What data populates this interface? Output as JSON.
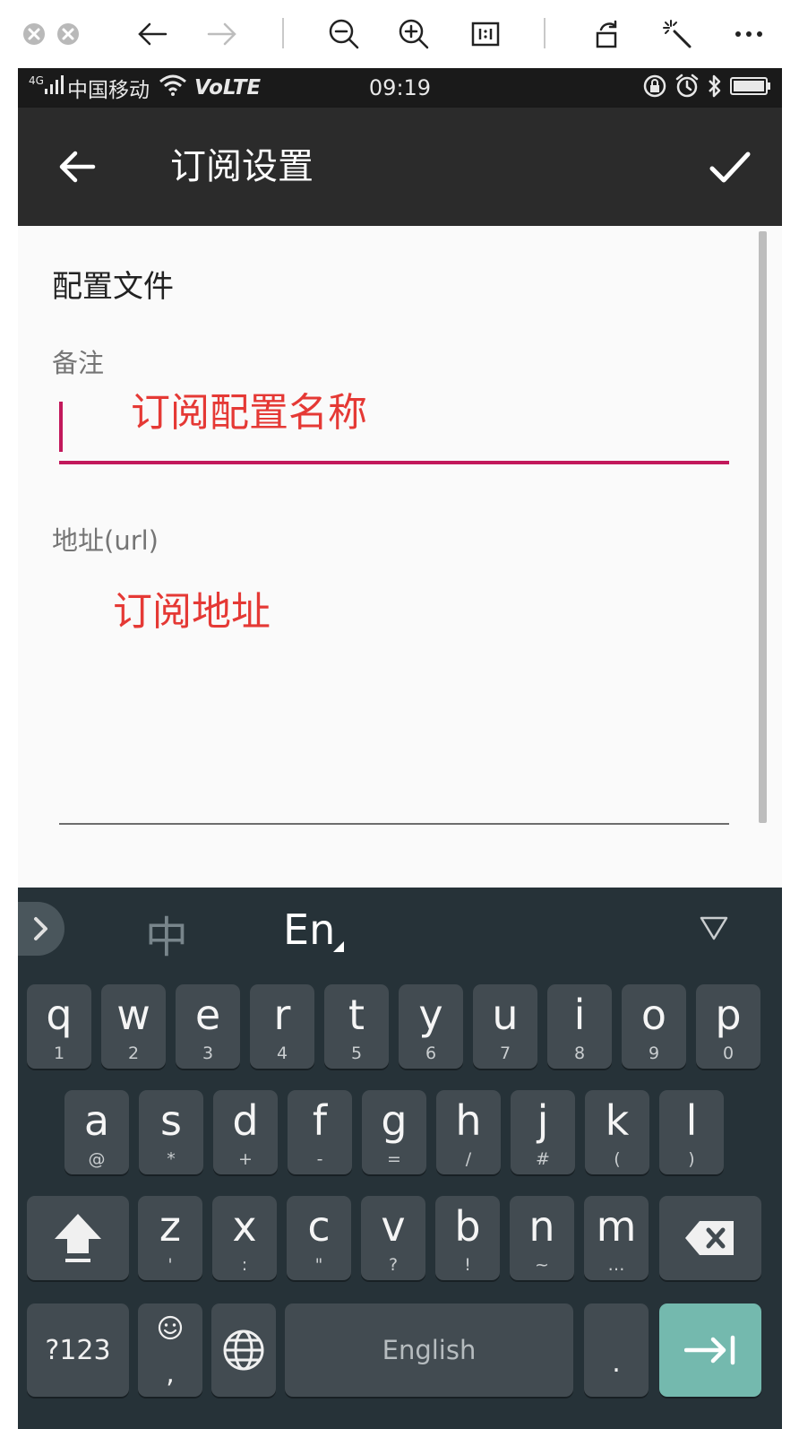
{
  "status_bar": {
    "network": "4G",
    "carrier": "中国移动",
    "volte": "VoLTE",
    "time": "09:19"
  },
  "app_bar": {
    "title": "订阅设置"
  },
  "form": {
    "section_title": "配置文件",
    "remark_label": "备注",
    "remark_hint": "订阅配置名称",
    "url_label": "地址(url)",
    "url_hint": "订阅地址"
  },
  "keyboard": {
    "lang_zh": "中",
    "lang_en": "En",
    "row1": [
      {
        "main": "q",
        "sub": "1"
      },
      {
        "main": "w",
        "sub": "2"
      },
      {
        "main": "e",
        "sub": "3"
      },
      {
        "main": "r",
        "sub": "4"
      },
      {
        "main": "t",
        "sub": "5"
      },
      {
        "main": "y",
        "sub": "6"
      },
      {
        "main": "u",
        "sub": "7"
      },
      {
        "main": "i",
        "sub": "8"
      },
      {
        "main": "o",
        "sub": "9"
      },
      {
        "main": "p",
        "sub": "0"
      }
    ],
    "row2": [
      {
        "main": "a",
        "sub": "@"
      },
      {
        "main": "s",
        "sub": "*"
      },
      {
        "main": "d",
        "sub": "+"
      },
      {
        "main": "f",
        "sub": "-"
      },
      {
        "main": "g",
        "sub": "="
      },
      {
        "main": "h",
        "sub": "/"
      },
      {
        "main": "j",
        "sub": "#"
      },
      {
        "main": "k",
        "sub": "("
      },
      {
        "main": "l",
        "sub": ")"
      }
    ],
    "row3": [
      {
        "main": "z",
        "sub": "'"
      },
      {
        "main": "x",
        "sub": ":"
      },
      {
        "main": "c",
        "sub": "\""
      },
      {
        "main": "v",
        "sub": "?"
      },
      {
        "main": "b",
        "sub": "!"
      },
      {
        "main": "n",
        "sub": "~"
      },
      {
        "main": "m",
        "sub": "…"
      }
    ],
    "sym_label": "?123",
    "emoji_sub": ",",
    "space_label": "English",
    "period_label": ".",
    "colors": {
      "background": "#263238",
      "key": "#424b51",
      "enter": "#74b9ae",
      "accent": "#c2185b",
      "hint": "#e53935"
    }
  }
}
